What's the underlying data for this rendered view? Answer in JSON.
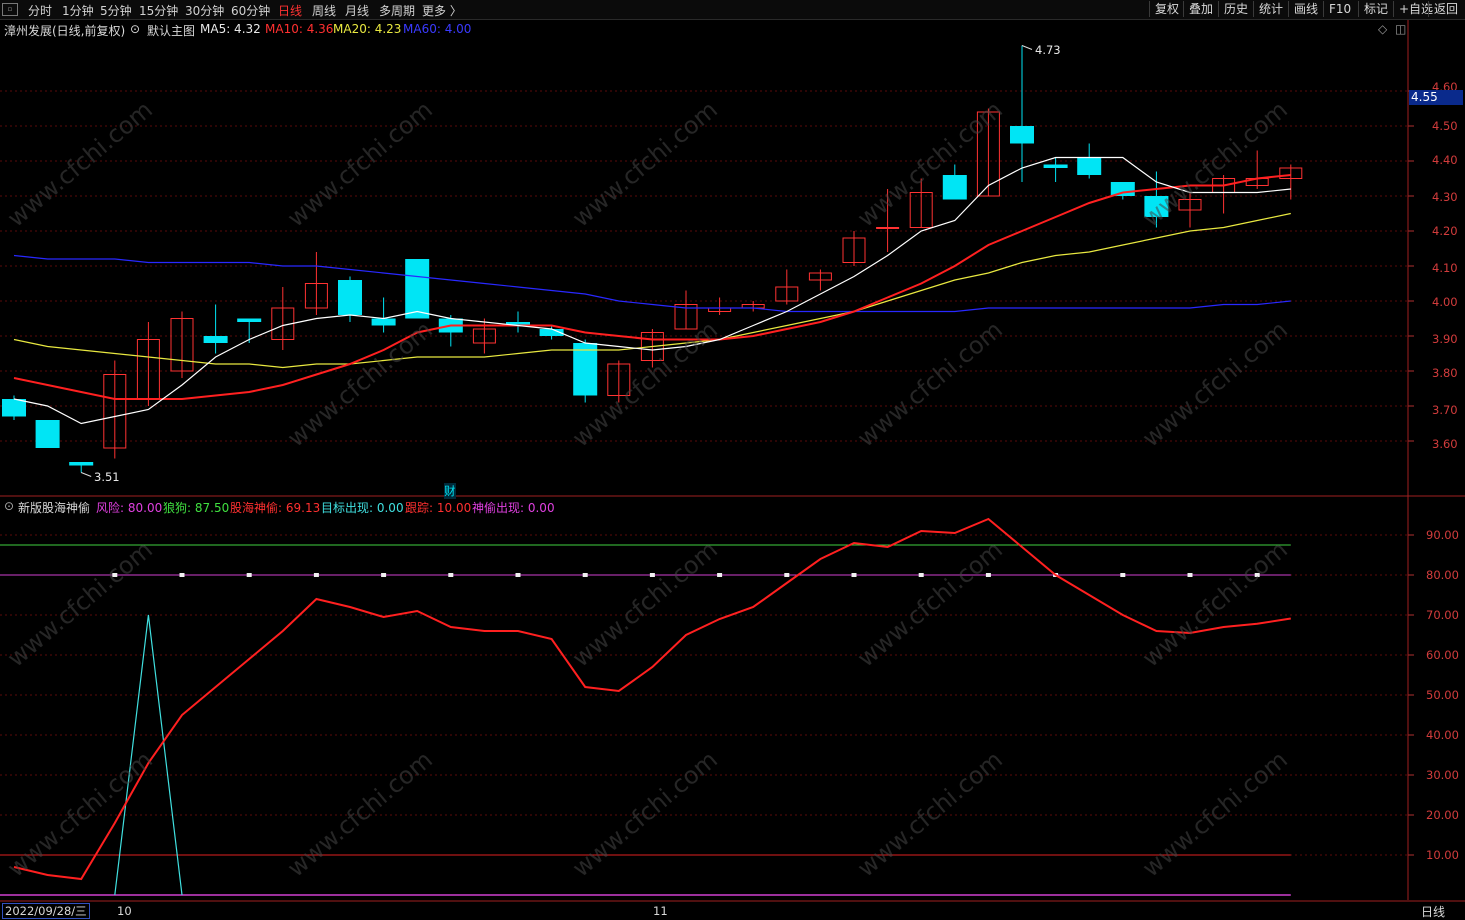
{
  "toolbar": {
    "corner_icon": "window-icon",
    "periods": [
      "分时",
      "1分钟",
      "5分钟",
      "15分钟",
      "30分钟",
      "60分钟",
      "日线",
      "周线",
      "月线",
      "多周期",
      "更多 〉"
    ],
    "active_period": "日线",
    "right_buttons": [
      "复权",
      "叠加",
      "历史",
      "统计",
      "画线",
      "F10",
      "标记",
      "+自选",
      "返回"
    ]
  },
  "main_panel": {
    "stock_title": "漳州发展(日线,前复权)",
    "template_label": "默认主图",
    "ma5_label": "MA5: 4.32",
    "ma10_label": "MA10: 4.36",
    "ma20_label": "MA20: 4.23",
    "ma60_label": "MA60: 4.00",
    "high_annotation": "4.73",
    "low_annotation": "3.51",
    "event_marker": "财",
    "current_price": "4.55",
    "y_ticks": [
      "4.60",
      "4.50",
      "4.40",
      "4.30",
      "4.20",
      "4.10",
      "4.00",
      "3.90",
      "3.80",
      "3.70",
      "3.60"
    ],
    "colors": {
      "up": "#ff3232",
      "down": "#00e5f5",
      "ma5": "#ffffff",
      "ma10": "#ff2020",
      "ma20": "#e8e840",
      "ma60": "#2828ff",
      "grid": "#5a0a0a"
    }
  },
  "indicator_panel": {
    "name": "新版股海神偷",
    "risk_label": "风险: 80.00",
    "wolf_label": "狼狗: 87.50",
    "thief_label": "股海神偷: 69.13",
    "target_label": "目标出现: 0.00",
    "track_label": "跟踪: 10.00",
    "appear_label": "神偷出现: 0.00",
    "y_ticks": [
      "90.00",
      "80.00",
      "70.00",
      "60.00",
      "50.00",
      "40.00",
      "30.00",
      "20.00",
      "10.00"
    ]
  },
  "footer": {
    "date": "2022/09/28/三",
    "month_10": "10",
    "month_11": "11",
    "period": "日线"
  },
  "watermark": "www.cfchi.com",
  "chart_data": {
    "type": "candlestick",
    "candles": [
      {
        "o": 3.72,
        "h": 3.73,
        "l": 3.66,
        "c": 3.67
      },
      {
        "o": 3.66,
        "h": 3.66,
        "l": 3.59,
        "c": 3.58
      },
      {
        "o": 3.54,
        "h": 3.54,
        "l": 3.51,
        "c": 3.53
      },
      {
        "o": 3.58,
        "h": 3.83,
        "l": 3.55,
        "c": 3.79
      },
      {
        "o": 3.72,
        "h": 3.94,
        "l": 3.7,
        "c": 3.89
      },
      {
        "o": 3.8,
        "h": 3.97,
        "l": 3.78,
        "c": 3.95
      },
      {
        "o": 3.9,
        "h": 3.99,
        "l": 3.85,
        "c": 3.88
      },
      {
        "o": 3.95,
        "h": 3.95,
        "l": 3.88,
        "c": 3.94
      },
      {
        "o": 3.89,
        "h": 4.04,
        "l": 3.86,
        "c": 3.98
      },
      {
        "o": 3.98,
        "h": 4.14,
        "l": 3.96,
        "c": 4.05
      },
      {
        "o": 4.06,
        "h": 4.07,
        "l": 3.94,
        "c": 3.96
      },
      {
        "o": 3.95,
        "h": 4.01,
        "l": 3.91,
        "c": 3.93
      },
      {
        "o": 4.12,
        "h": 4.12,
        "l": 3.96,
        "c": 3.95
      },
      {
        "o": 3.95,
        "h": 3.96,
        "l": 3.87,
        "c": 3.91
      },
      {
        "o": 3.88,
        "h": 3.95,
        "l": 3.85,
        "c": 3.92
      },
      {
        "o": 3.94,
        "h": 3.97,
        "l": 3.91,
        "c": 3.93
      },
      {
        "o": 3.92,
        "h": 3.93,
        "l": 3.89,
        "c": 3.9
      },
      {
        "o": 3.88,
        "h": 3.89,
        "l": 3.71,
        "c": 3.73
      },
      {
        "o": 3.73,
        "h": 3.83,
        "l": 3.71,
        "c": 3.82
      },
      {
        "o": 3.83,
        "h": 3.92,
        "l": 3.81,
        "c": 3.91
      },
      {
        "o": 3.92,
        "h": 4.03,
        "l": 3.92,
        "c": 3.99
      },
      {
        "o": 3.97,
        "h": 4.01,
        "l": 3.96,
        "c": 3.98
      },
      {
        "o": 3.98,
        "h": 4.0,
        "l": 3.97,
        "c": 3.99
      },
      {
        "o": 4.0,
        "h": 4.09,
        "l": 3.99,
        "c": 4.04
      },
      {
        "o": 4.06,
        "h": 4.09,
        "l": 4.03,
        "c": 4.08
      },
      {
        "o": 4.11,
        "h": 4.2,
        "l": 4.1,
        "c": 4.18
      },
      {
        "o": 4.21,
        "h": 4.32,
        "l": 4.14,
        "c": 4.21
      },
      {
        "o": 4.21,
        "h": 4.35,
        "l": 4.21,
        "c": 4.31
      },
      {
        "o": 4.36,
        "h": 4.39,
        "l": 4.3,
        "c": 4.29
      },
      {
        "o": 4.3,
        "h": 4.55,
        "l": 4.3,
        "c": 4.54
      },
      {
        "o": 4.5,
        "h": 4.73,
        "l": 4.34,
        "c": 4.45
      },
      {
        "o": 4.39,
        "h": 4.41,
        "l": 4.34,
        "c": 4.38
      },
      {
        "o": 4.41,
        "h": 4.45,
        "l": 4.35,
        "c": 4.36
      },
      {
        "o": 4.34,
        "h": 4.34,
        "l": 4.29,
        "c": 4.3
      },
      {
        "o": 4.3,
        "h": 4.37,
        "l": 4.21,
        "c": 4.24
      },
      {
        "o": 4.26,
        "h": 4.31,
        "l": 4.21,
        "c": 4.29
      },
      {
        "o": 4.31,
        "h": 4.36,
        "l": 4.25,
        "c": 4.35
      },
      {
        "o": 4.33,
        "h": 4.43,
        "l": 4.32,
        "c": 4.35
      },
      {
        "o": 4.35,
        "h": 4.39,
        "l": 4.29,
        "c": 4.38
      }
    ],
    "ma5": [
      3.72,
      3.7,
      3.65,
      3.67,
      3.69,
      3.76,
      3.84,
      3.89,
      3.93,
      3.95,
      3.96,
      3.95,
      3.97,
      3.95,
      3.94,
      3.93,
      3.92,
      3.88,
      3.87,
      3.86,
      3.87,
      3.89,
      3.93,
      3.97,
      4.02,
      4.07,
      4.13,
      4.2,
      4.23,
      4.33,
      4.38,
      4.41,
      4.41,
      4.41,
      4.34,
      4.31,
      4.31,
      4.31,
      4.32
    ],
    "ma10": [
      3.78,
      3.76,
      3.74,
      3.72,
      3.72,
      3.72,
      3.73,
      3.74,
      3.76,
      3.79,
      3.82,
      3.86,
      3.91,
      3.93,
      3.93,
      3.93,
      3.93,
      3.91,
      3.9,
      3.89,
      3.89,
      3.89,
      3.9,
      3.92,
      3.94,
      3.97,
      4.01,
      4.05,
      4.1,
      4.16,
      4.2,
      4.24,
      4.28,
      4.31,
      4.32,
      4.33,
      4.33,
      4.35,
      4.36
    ],
    "ma20": [
      3.89,
      3.87,
      3.86,
      3.85,
      3.84,
      3.83,
      3.82,
      3.82,
      3.81,
      3.82,
      3.82,
      3.83,
      3.84,
      3.84,
      3.84,
      3.85,
      3.86,
      3.86,
      3.86,
      3.87,
      3.88,
      3.89,
      3.91,
      3.93,
      3.95,
      3.97,
      4.0,
      4.03,
      4.06,
      4.08,
      4.11,
      4.13,
      4.14,
      4.16,
      4.18,
      4.2,
      4.21,
      4.23,
      4.25
    ],
    "ma60": [
      4.13,
      4.12,
      4.12,
      4.12,
      4.11,
      4.11,
      4.11,
      4.11,
      4.1,
      4.1,
      4.09,
      4.08,
      4.07,
      4.06,
      4.05,
      4.04,
      4.03,
      4.02,
      4.0,
      3.99,
      3.98,
      3.98,
      3.98,
      3.97,
      3.97,
      3.97,
      3.97,
      3.97,
      3.97,
      3.98,
      3.98,
      3.98,
      3.98,
      3.98,
      3.98,
      3.98,
      3.99,
      3.99,
      4.0
    ],
    "indicator": {
      "thief": [
        7,
        5,
        4,
        18,
        33,
        45,
        52,
        59,
        66,
        74,
        72,
        69.5,
        71,
        67,
        66,
        66,
        64,
        52,
        51,
        57,
        65,
        69,
        72,
        78,
        84,
        88,
        87,
        91,
        90.5,
        94,
        87,
        80,
        75,
        70,
        66,
        65.5,
        67,
        67.8,
        69.13
      ],
      "target_spike": {
        "index": 4,
        "value": 70
      },
      "risk": 80.0,
      "wolf": 87.5,
      "track": 10.0,
      "y_range": [
        0,
        100
      ]
    },
    "y_range": [
      3.47,
      4.72
    ]
  }
}
